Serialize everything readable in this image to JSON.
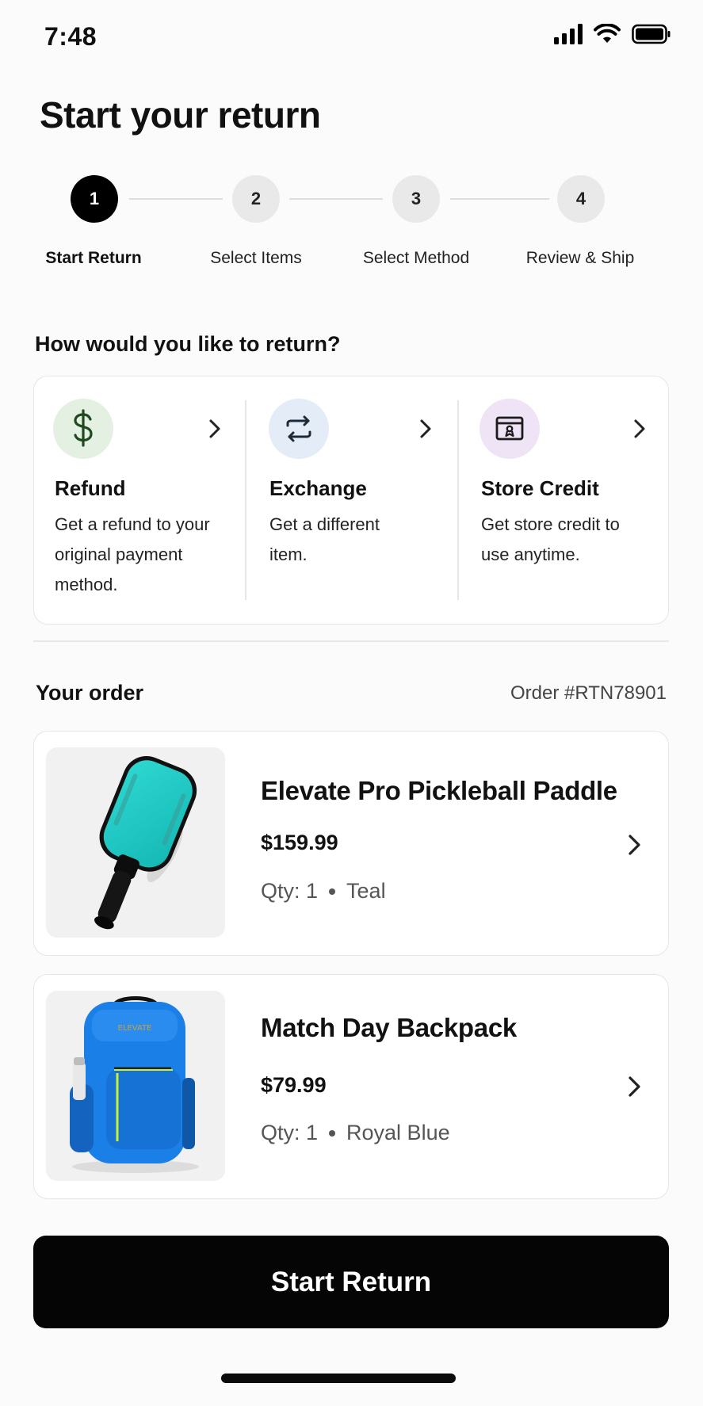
{
  "status_bar": {
    "time": "7:48",
    "icons": [
      "signal-icon",
      "wifi-icon",
      "battery-icon"
    ]
  },
  "page_title": "Start your return",
  "stepper": {
    "steps": [
      {
        "number": "1",
        "label": "Start Return",
        "active": true
      },
      {
        "number": "2",
        "label": "Select Items",
        "active": false
      },
      {
        "number": "3",
        "label": "Select Method",
        "active": false
      },
      {
        "number": "4",
        "label": "Review & Ship",
        "active": false
      }
    ]
  },
  "methods_section": {
    "title": "How would you like to return?",
    "methods": [
      {
        "icon": "dollar-icon",
        "title": "Refund",
        "description": "Get a refund to your original payment method.",
        "icon_bg": "#e4f0e2"
      },
      {
        "icon": "exchange-arrows-icon",
        "title": "Exchange",
        "description": "Get a different item.",
        "icon_bg": "#e3ecf7"
      },
      {
        "icon": "store-credit-icon",
        "title": "Store Credit",
        "description": "Get store credit to use anytime.",
        "icon_bg": "#efe4f5"
      }
    ]
  },
  "order": {
    "heading": "Your order",
    "number": "Order #RTN78901",
    "items": [
      {
        "name": "Elevate Pro Pickleball Paddle",
        "price": "$159.99",
        "qty": "Qty: 1",
        "color": "Teal",
        "image": "pickleball-paddle-image"
      },
      {
        "name": "Match Day Backpack",
        "price": "$79.99",
        "qty": "Qty: 1",
        "color": "Royal Blue",
        "image": "backpack-image",
        "image_brand_text": "ELEVATE"
      }
    ]
  },
  "cta": {
    "label": "Start Return"
  },
  "colors": {
    "primary": "#000000",
    "teal": "#1fc9c4",
    "royal_blue": "#1a7fe6"
  }
}
